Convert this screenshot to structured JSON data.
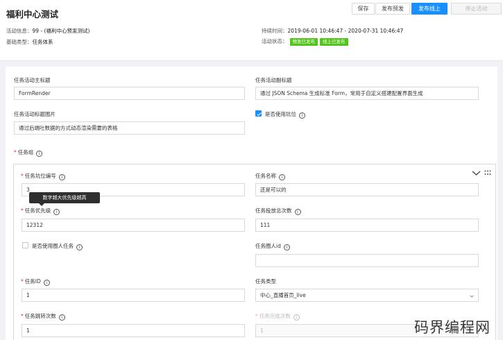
{
  "header": {
    "title": "福利中心测试",
    "buttons": {
      "save": "保存",
      "preview": "发布预发",
      "publish": "发布线上",
      "stop": "停止活动"
    },
    "meta": {
      "activity_info_label": "活动信息：",
      "activity_info_value": "99 - (福利中心预发测试)",
      "base_type_label": "基础类型：",
      "base_type_value": "任务体系",
      "duration_label": "持续时间：",
      "duration_value": "2019-06-01 10:46:47 - 2020-07-31 10:46:47",
      "status_label": "活动状态：",
      "status_tags": [
        "预发已发布",
        "线上已发布"
      ]
    }
  },
  "form": {
    "main_title_label": "任务活动主标题",
    "main_title_value": "FormRender",
    "sub_title_label": "任务活动副标题",
    "sub_title_value": "通过 JSON Schema 生成标准 Form，常用于自定义搭建配置界面生成",
    "title_image_label": "任务活动标题图片",
    "title_image_value": "通过后端吐数据的方式动态渲染需要的表格",
    "use_slot_label": "是否使用坑位",
    "task_group_label": "任务组",
    "group": {
      "slot_no_label": "任务坑位编号",
      "slot_no_value": "3",
      "tooltip": "数字越大优先级越高",
      "task_name_label": "任务名称",
      "task_name_value": "还是可以的",
      "priority_label": "任务优先级",
      "priority_value": "12312",
      "delivery_total_label": "任务投放总次数",
      "delivery_total_value": "111",
      "use_crowd_label": "是否使用圈人任务",
      "crowd_id_label": "任务圈人id",
      "crowd_id_value": "",
      "task_id_label": "任务ID",
      "task_id_value": "1",
      "task_type_label": "任务类型",
      "task_type_value": "中心_直播首页_live",
      "jump_count_label": "任务跳转次数",
      "jump_count_value": "1",
      "complete_count_label": "任务完成次数",
      "complete_count_value": "1"
    }
  },
  "watermark": "码界编程网",
  "icons": {
    "info": "info-circle-icon",
    "collapse": "chevron-down-icon",
    "drag": "drag-handle-icon"
  },
  "colors": {
    "primary": "#1890ff",
    "success_tag": "#52c41a",
    "required": "#f5222d"
  }
}
